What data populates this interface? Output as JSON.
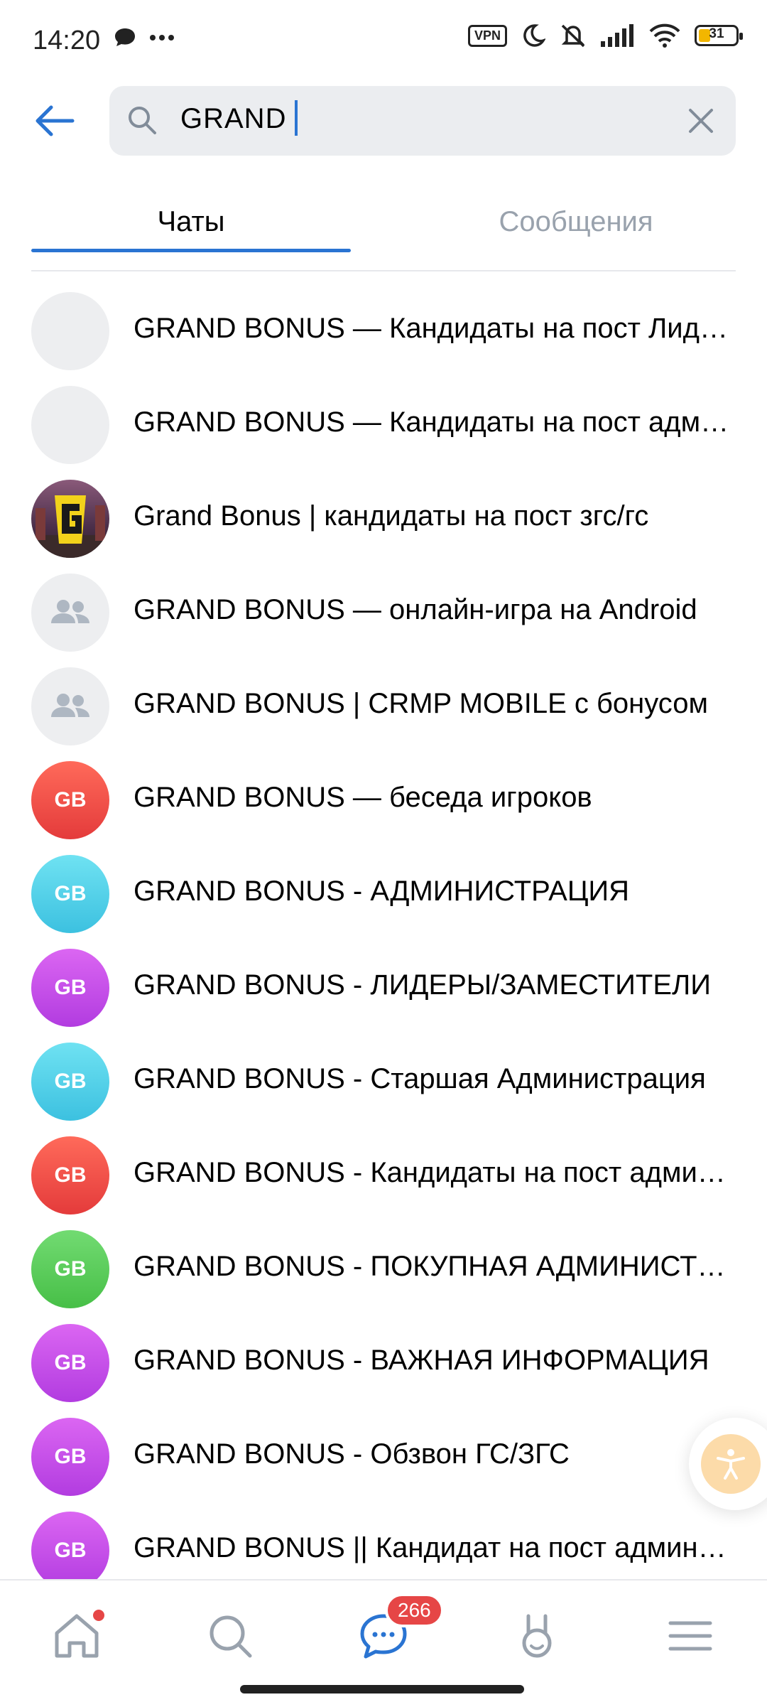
{
  "status_bar": {
    "time": "14:20",
    "vpn": "VPN",
    "battery": "31",
    "battery_level": 0.31
  },
  "search": {
    "query": "GRAND"
  },
  "tabs": [
    {
      "label": "Чаты",
      "active": true
    },
    {
      "label": "Сообщения",
      "active": false
    }
  ],
  "results": [
    {
      "title": "GRAND BONUS — Кандидаты на пост Лидеров",
      "avatar": "blank"
    },
    {
      "title": "GRAND BONUS — Кандидаты на пост администратора",
      "avatar": "blank"
    },
    {
      "title": "Grand Bonus | кандидаты на пост згс/гс",
      "avatar": "photo"
    },
    {
      "title": "GRAND BONUS — онлайн-игра на Android",
      "avatar": "group-icon"
    },
    {
      "title": "GRAND BONUS | CRMP MOBILE с бонусом",
      "avatar": "group-icon"
    },
    {
      "title": "GRAND BONUS — беседа игроков",
      "avatar": "initials",
      "initials": "GB",
      "color": "#f0504f"
    },
    {
      "title": "GRAND BONUS - АДМИНИСТРАЦИЯ",
      "avatar": "initials",
      "initials": "GB",
      "color": "#56d1e8"
    },
    {
      "title": "GRAND BONUS - ЛИДЕРЫ/ЗАМЕСТИТЕЛИ",
      "avatar": "initials",
      "initials": "GB",
      "color": "#c44ee8"
    },
    {
      "title": "GRAND BONUS - Старшая Администрация",
      "avatar": "initials",
      "initials": "GB",
      "color": "#56d1e8"
    },
    {
      "title": "GRAND BONUS - Кандидаты на пост администратора",
      "avatar": "initials",
      "initials": "GB",
      "color": "#f0504f"
    },
    {
      "title": "GRAND BONUS - ПОКУПНАЯ АДМИНИСТРАЦИЯ",
      "avatar": "initials",
      "initials": "GB",
      "color": "#5ccf5c"
    },
    {
      "title": "GRAND BONUS - ВАЖНАЯ ИНФОРМАЦИЯ",
      "avatar": "initials",
      "initials": "GB",
      "color": "#c44ee8"
    },
    {
      "title": "GRAND BONUS - Обзвон ГС/ЗГС",
      "avatar": "initials",
      "initials": "GB",
      "color": "#c44ee8"
    },
    {
      "title": "GRAND BONUS || Кандидат на пост администратора",
      "avatar": "initials",
      "initials": "GB",
      "color": "#c44ee8"
    }
  ],
  "bottom_nav": {
    "items": [
      "home-icon",
      "search-icon",
      "messages-icon",
      "clips-icon",
      "menu-icon"
    ],
    "messages_badge": "266"
  },
  "colors": {
    "accent": "#2a74d2",
    "badge": "#e64646"
  }
}
